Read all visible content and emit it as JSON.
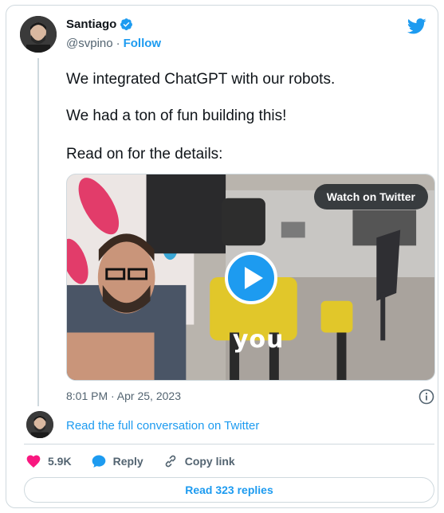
{
  "author": {
    "name": "Santiago",
    "handle": "@svpino",
    "separator": "·",
    "follow_label": "Follow"
  },
  "tweet": {
    "lines": [
      "We integrated ChatGPT with our robots.",
      "We had a ton of fun building this!",
      "Read on for the details:"
    ]
  },
  "media": {
    "watch_label": "Watch on Twitter",
    "caption": "you"
  },
  "timestamp": "8:01 PM · Apr 25, 2023",
  "conversation_link": "Read the full conversation on Twitter",
  "actions": {
    "likes": "5.9K",
    "reply_label": "Reply",
    "copy_label": "Copy link"
  },
  "replies_button": "Read 323 replies",
  "colors": {
    "accent": "#1d9bf0",
    "like": "#f91880",
    "text": "#0f1419",
    "secondary": "#536471"
  },
  "icons": [
    "verified-badge-icon",
    "twitter-bird-icon",
    "play-icon",
    "info-icon",
    "heart-icon",
    "reply-bubble-icon",
    "link-icon"
  ]
}
